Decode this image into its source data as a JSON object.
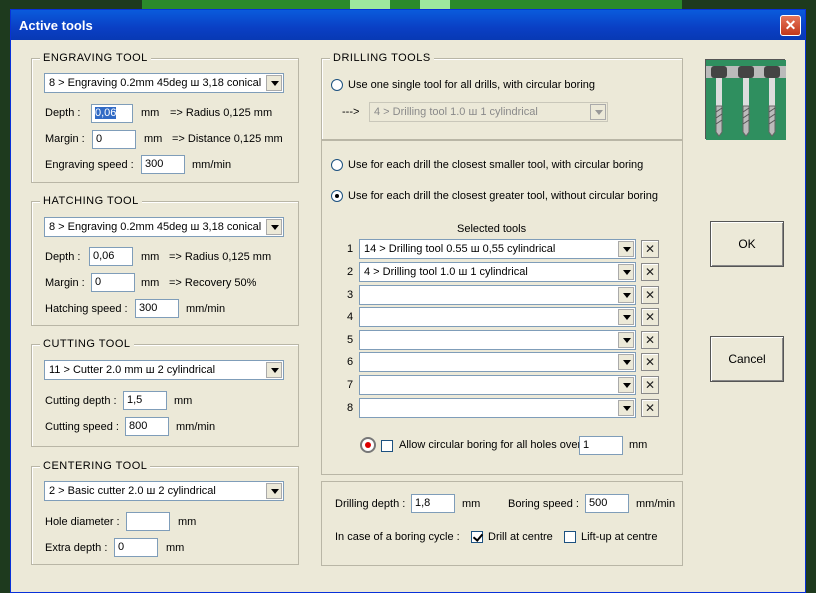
{
  "window": {
    "title": "Active tools",
    "close_label": "✕"
  },
  "engraving": {
    "legend": "ENGRAVING TOOL",
    "tool": "8 > Engraving 0.2mm 45deg   ш 3,18   conical",
    "depth_label": "Depth :",
    "depth_value": "0,06",
    "depth_unit": "mm",
    "depth_info": "=> Radius 0,125 mm",
    "margin_label": "Margin :",
    "margin_value": "0",
    "margin_unit": "mm",
    "margin_info": "=> Distance 0,125 mm",
    "speed_label": "Engraving speed :",
    "speed_value": "300",
    "speed_unit": "mm/min"
  },
  "hatching": {
    "legend": "HATCHING TOOL",
    "tool": "8 > Engraving 0.2mm 45deg   ш 3,18   conical",
    "depth_label": "Depth :",
    "depth_value": "0,06",
    "depth_unit": "mm",
    "depth_info": "=> Radius 0,125 mm",
    "margin_label": "Margin :",
    "margin_value": "0",
    "margin_unit": "mm",
    "margin_info": "=> Recovery 50%",
    "speed_label": "Hatching speed :",
    "speed_value": "300",
    "speed_unit": "mm/min"
  },
  "cutting": {
    "legend": "CUTTING TOOL",
    "tool": "11 > Cutter 2.0 mm   ш 2   cylindrical",
    "depth_label": "Cutting depth :",
    "depth_value": "1,5",
    "depth_unit": "mm",
    "speed_label": "Cutting speed :",
    "speed_value": "800",
    "speed_unit": "mm/min"
  },
  "centering": {
    "legend": "CENTERING TOOL",
    "tool": "2 > Basic cutter 2.0   ш 2   cylindrical",
    "hole_label": "Hole diameter :",
    "hole_value": "",
    "hole_unit": "mm",
    "extra_label": "Extra depth :",
    "extra_value": "0",
    "extra_unit": "mm"
  },
  "drilling": {
    "legend": "DRILLING TOOLS",
    "option_single": "Use one single tool for all drills, with circular boring",
    "single_arrow": "--->",
    "single_tool": "4 > Drilling tool 1.0   ш 1   cylindrical",
    "option_smaller": "Use for each drill the closest smaller tool, with circular boring",
    "option_greater": "Use for each drill the closest greater tool, without circular boring",
    "selected_title": "Selected tools",
    "rows": [
      {
        "num": "1",
        "tool": "14 > Drilling tool 0.55   ш 0,55   cylindrical"
      },
      {
        "num": "2",
        "tool": "   4 > Drilling tool 1.0   ш 1   cylindrical"
      },
      {
        "num": "3",
        "tool": ""
      },
      {
        "num": "4",
        "tool": ""
      },
      {
        "num": "5",
        "tool": ""
      },
      {
        "num": "6",
        "tool": ""
      },
      {
        "num": "7",
        "tool": ""
      },
      {
        "num": "8",
        "tool": ""
      }
    ],
    "remove_label": "✕",
    "allow_boring_label": "Allow circular boring for all holes over",
    "allow_boring_value": "1",
    "allow_boring_unit": "mm",
    "drill_depth_label": "Drilling depth :",
    "drill_depth_value": "1,8",
    "drill_depth_unit": "mm",
    "boring_speed_label": "Boring speed :",
    "boring_speed_value": "500",
    "boring_speed_unit": "mm/min",
    "boring_cycle_label": "In case of a boring cycle :",
    "drill_centre_label": "Drill at centre",
    "liftup_centre_label": "Lift-up at centre"
  },
  "buttons": {
    "ok": "OK",
    "cancel": "Cancel"
  }
}
